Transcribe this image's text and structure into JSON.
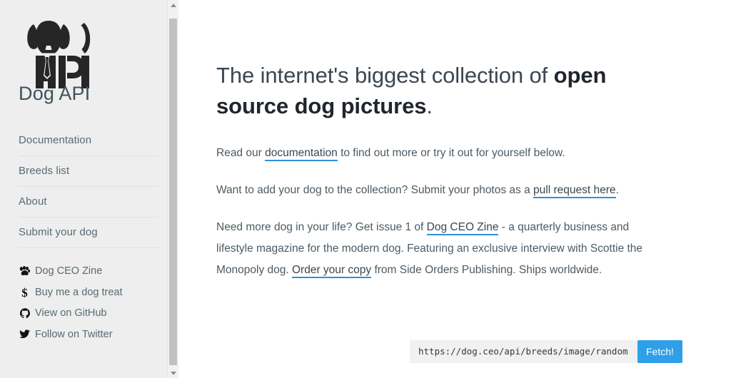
{
  "brand": {
    "logo_icon": "dog-api-logo-icon",
    "title": "Dog API"
  },
  "sidebar": {
    "nav_items": [
      {
        "label": "Documentation",
        "name": "documentation"
      },
      {
        "label": "Breeds list",
        "name": "breeds-list"
      },
      {
        "label": "About",
        "name": "about"
      },
      {
        "label": "Submit your dog",
        "name": "submit-your-dog"
      }
    ],
    "social_items": [
      {
        "label": "Dog CEO Zine",
        "icon": "paw-icon",
        "name": "dog-ceo-zine"
      },
      {
        "label": "Buy me a dog treat",
        "icon": "dollar-sign-icon",
        "name": "buy-me-a-dog-treat"
      },
      {
        "label": "View on GitHub",
        "icon": "github-icon",
        "name": "view-on-github"
      },
      {
        "label": "Follow on Twitter",
        "icon": "twitter-icon",
        "name": "follow-on-twitter"
      }
    ]
  },
  "scrollbar": {
    "up_arrow_icon": "caret-up-icon",
    "down_arrow_icon": "caret-down-icon"
  },
  "main": {
    "headline": {
      "prefix": "The internet's biggest collection of ",
      "bold": "open source dog pictures",
      "suffix": "."
    },
    "paragraph_1": {
      "part_1": "Read our ",
      "link_1": "documentation",
      "part_2": " to find out more or try it out for yourself below."
    },
    "paragraph_2": {
      "part_1": "Want to add your dog to the collection? Submit your photos as a ",
      "link_1": "pull request here",
      "part_2": "."
    },
    "paragraph_3": {
      "part_1": "Need more dog in your life? Get issue 1 of ",
      "link_1": "Dog CEO Zine",
      "part_2": " - a quarterly business and lifestyle magazine for the modern dog. Featuring an exclusive interview with Scottie the Monopoly dog. ",
      "link_2": "Order your copy",
      "part_3": " from Side Orders Publishing. Ships worldwide."
    },
    "fetch": {
      "url_value": "https://dog.ceo/api/breeds/image/random",
      "url_placeholder": "https://dog.ceo/api/breeds/image/random",
      "button_label": "Fetch!"
    }
  },
  "colors": {
    "sidebar_bg": "#eeeeee",
    "main_bg": "#ffffff",
    "accent_blue": "#2e9fe8",
    "link_underline": "#3091d8",
    "heading": "#3c4650",
    "body_text": "#4d5a63"
  }
}
